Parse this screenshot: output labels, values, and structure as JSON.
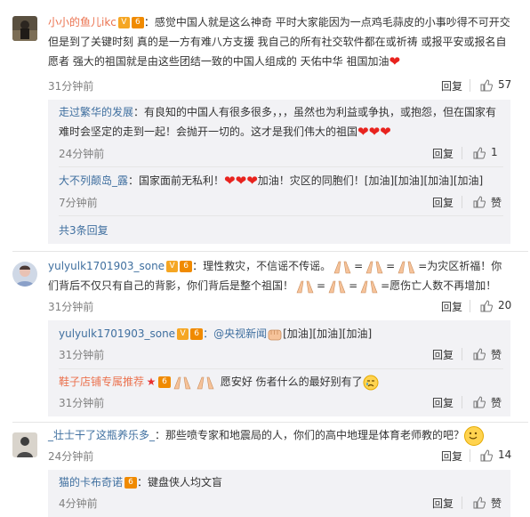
{
  "comments": [
    {
      "user": "小小的鱼儿ikc",
      "body": "：感觉中国人就是这么神奇 平时大家能因为一点鸡毛蒜皮的小事吵得不可开交 但是到了关键时刻 真的是一方有难八方支援 我自己的所有社交软件都在或祈祷 或报平安或报名自愿者 强大的祖国就是由这些团结一致的中国人组成的 天佑中华 祖国加油",
      "time": "31分钟前",
      "reply_label": "回复",
      "likes": "57",
      "replies": [
        {
          "user": "走过繁华的发展",
          "body": "：有良知的中国人有很多很多，，，虽然也为利益或争执，或抱怨，但在国家有难时会坚定的走到一起！会抛开一切的。这才是我们伟大的祖国",
          "time": "24分钟前",
          "reply_label": "回复",
          "likes": "1"
        },
        {
          "user": "大不列颠岛_露",
          "body_pre": "：国家面前无私利！",
          "body_post": "加油！灾区的同胞们！[加油][加油][加油][加油]",
          "time": "7分钟前",
          "reply_label": "回复",
          "likes": "赞"
        }
      ],
      "more": "共3条回复"
    },
    {
      "user": "yulyulk1701903_sone",
      "body_a": "：理性救灾，不信谣不传谣。",
      "body_b": "=为灾区祈福！你们背后不仅只有自己的背影，你们背后是整个祖国！",
      "body_c": "=愿伤亡人数不再增加！",
      "time": "31分钟前",
      "reply_label": "回复",
      "likes": "20",
      "replies": [
        {
          "user": "yulyulk1701903_sone",
          "mention": "：@央视新闻",
          "body": "[加油][加油][加油]",
          "time": "31分钟前",
          "reply_label": "回复",
          "likes": "赞"
        },
        {
          "user": "鞋子店铺专属推荐",
          "body": "愿安好 伤者什么的最好别有了",
          "time": "31分钟前",
          "reply_label": "回复",
          "likes": "赞"
        }
      ]
    },
    {
      "user": "_壮士干了这瓶养乐多_",
      "body": "：那些喷专家和地震局的人，你们的高中地理是体育老师教的吧？",
      "time": "24分钟前",
      "reply_label": "回复",
      "likes": "14",
      "replies": [
        {
          "user": "猫的卡布奇诺",
          "body": "：键盘侠人均文盲",
          "time": "4分钟前",
          "reply_label": "回复",
          "likes": "赞"
        }
      ]
    }
  ],
  "colors": {
    "username_orange": "#eb7350",
    "username_blue": "#3f6f9f",
    "reply_bg": "#f2f2f5",
    "heart": "#e8231e"
  }
}
